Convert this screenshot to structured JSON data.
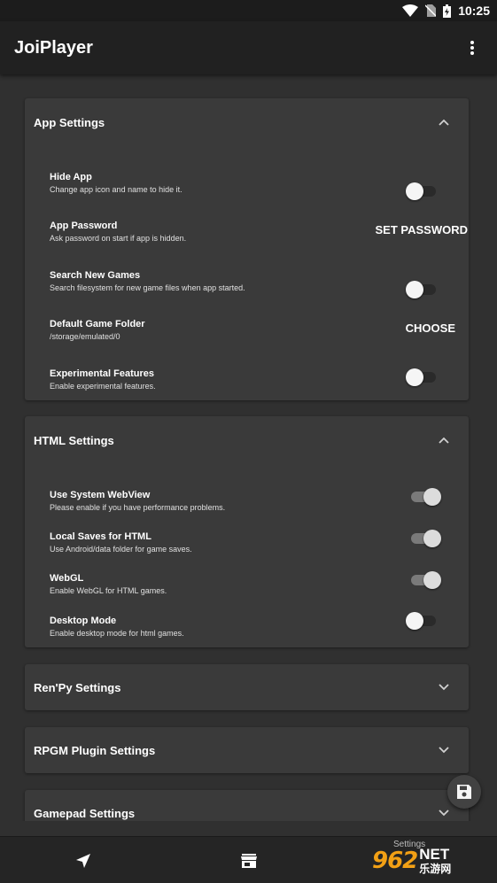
{
  "status_bar": {
    "time": "10:25",
    "icons": [
      "wifi-icon",
      "no-sim-icon",
      "battery-charging-icon"
    ]
  },
  "app_bar": {
    "title": "JoiPlayer",
    "menu_icon": "more-vert-icon"
  },
  "sections": {
    "app": {
      "title": "App Settings",
      "expanded": true,
      "rows": [
        {
          "title": "Hide App",
          "subtitle": "Change app icon and name to hide it.",
          "control": "toggle",
          "on": false
        },
        {
          "title": "App Password",
          "subtitle": "Ask password on start if app is hidden.",
          "control": "button",
          "action": "SET PASSWORD"
        },
        {
          "title": "Search New Games",
          "subtitle": "Search filesystem for new game files when app started.",
          "control": "toggle",
          "on": false
        },
        {
          "title": "Default Game Folder",
          "subtitle": "/storage/emulated/0",
          "control": "button",
          "action": "CHOOSE"
        },
        {
          "title": "Experimental Features",
          "subtitle": "Enable experimental features.",
          "control": "toggle",
          "on": false
        }
      ]
    },
    "html": {
      "title": "HTML Settings",
      "expanded": true,
      "rows": [
        {
          "title": "Use System WebView",
          "subtitle": "Please enable if you have performance problems.",
          "control": "toggle",
          "on": true
        },
        {
          "title": "Local Saves for HTML",
          "subtitle": "Use Android/data folder for game saves.",
          "control": "toggle",
          "on": true
        },
        {
          "title": "WebGL",
          "subtitle": "Enable WebGL for HTML games.",
          "control": "toggle",
          "on": true
        },
        {
          "title": "Desktop Mode",
          "subtitle": "Enable desktop mode for html games.",
          "control": "toggle",
          "on": false
        }
      ]
    },
    "renpy": {
      "title": "Ren'Py Settings",
      "expanded": false
    },
    "rpgm": {
      "title": "RPGM Plugin Settings",
      "expanded": false
    },
    "gamepad": {
      "title": "Gamepad Settings",
      "expanded": false
    }
  },
  "fab": {
    "icon": "save-icon"
  },
  "bottom_nav": {
    "items": [
      {
        "icon": "navigation-arrow-icon"
      },
      {
        "icon": "store-icon"
      },
      {
        "label": "Settings"
      }
    ]
  },
  "watermark": {
    "logo": "962",
    "net": "NET",
    "cn": "乐游网"
  },
  "colors": {
    "background": "#303030",
    "card": "#3a3a3a",
    "app_bar": "#212121",
    "status_bar": "#1c1c1c"
  }
}
